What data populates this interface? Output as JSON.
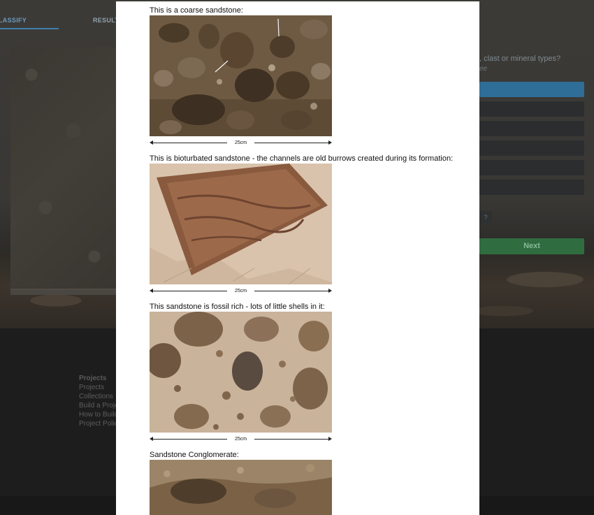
{
  "background": {
    "tabs": {
      "classify": "LASSIFY",
      "result": "RESULT"
    },
    "question": {
      "text": ", clast or mineral types?",
      "subtext": "ee"
    },
    "help_button": "?",
    "next_button": "Next",
    "footer": {
      "heading": "Projects",
      "links": [
        "Projects",
        "Collections",
        "Build a Proje",
        "How to Build",
        "Project Polic"
      ]
    }
  },
  "modal": {
    "examples": [
      {
        "caption": "This is a coarse sandstone:",
        "scale": "25cm",
        "photo": "coarse-sandstone-photo"
      },
      {
        "caption": "This is bioturbated sandstone - the channels are old burrows created during its formation:",
        "scale": "25cm",
        "photo": "bioturbated-sandstone-photo"
      },
      {
        "caption": "This sandstone is fossil rich - lots of little shells in it:",
        "scale": "25cm",
        "photo": "fossil-rich-sandstone-photo"
      },
      {
        "caption": "Sandstone Conglomerate:",
        "scale": "",
        "photo": "sandstone-conglomerate-photo"
      }
    ]
  },
  "colors": {
    "accent_blue": "#2f6e97",
    "next_green": "#2f6d40",
    "modal_bg": "#ffffff"
  }
}
